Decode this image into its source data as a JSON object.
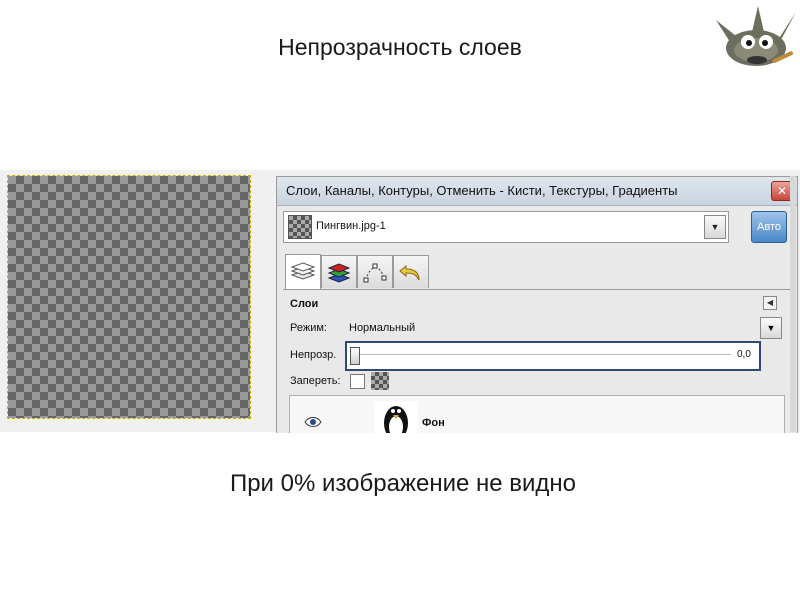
{
  "slide": {
    "title": "Непрозрачность слоев",
    "caption": "При 0% изображение не видно"
  },
  "dock": {
    "title": "Слои, Каналы, Контуры, Отменить - Кисти, Текстуры, Градиенты",
    "close_glyph": "✕",
    "image_name": "Пингвин.jpg-1",
    "dropdown_glyph": "▼",
    "auto_label": "Авто",
    "tabs": [
      {
        "name": "layers-tab",
        "icon": "layers-icon",
        "active": true
      },
      {
        "name": "channels-tab",
        "icon": "channels-icon",
        "active": false
      },
      {
        "name": "paths-tab",
        "icon": "paths-icon",
        "active": false
      },
      {
        "name": "undo-tab",
        "icon": "undo-icon",
        "active": false
      }
    ]
  },
  "layers": {
    "section_title": "Слои",
    "collapse_glyph": "◀",
    "mode_label": "Режим:",
    "mode_value": "Нормальный",
    "mode_dropdown_glyph": "▼",
    "opacity_label": "Непрозр.",
    "opacity_value": "0,0",
    "opacity_fraction": 0.0,
    "lock_label": "Запереть:",
    "layer_name": "Фон"
  },
  "colors": {
    "highlight_border": "#2c4a73",
    "checker_dark": "#666666",
    "checker_light": "#999999",
    "selection_dash": "#c8b400"
  }
}
